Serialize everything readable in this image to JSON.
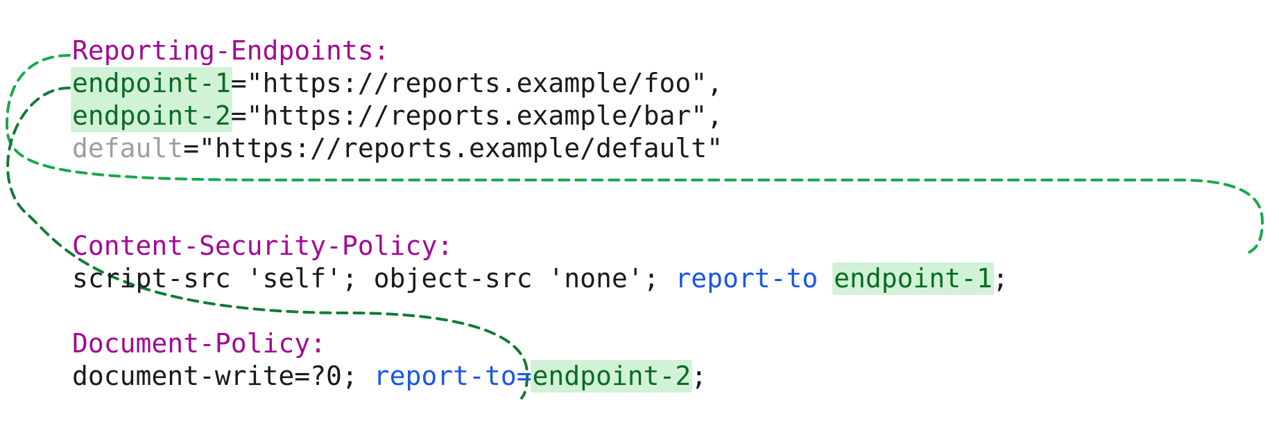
{
  "headers": {
    "reporting": "Reporting-Endpoints:",
    "csp": "Content-Security-Policy:",
    "doc": "Document-Policy:"
  },
  "endpoints": {
    "e1_name": "endpoint-1",
    "e1_rest": "=\"https://reports.example/foo\",",
    "e2_name": "endpoint-2",
    "e2_rest": "=\"https://reports.example/bar\",",
    "def_name": "default",
    "def_rest": "=\"https://reports.example/default\""
  },
  "csp": {
    "prefix": "script-src 'self'; object-src 'none'; ",
    "reportto": "report-to ",
    "endpoint": "endpoint-1",
    "tail": ";"
  },
  "docpolicy": {
    "prefix": "document-write=?0; ",
    "reportto": "report-to=",
    "endpoint": "endpoint-2",
    "tail": ";"
  },
  "colors": {
    "header": "#a30795",
    "highlight_bg": "#d1f2d6",
    "green_text": "#0b6b23",
    "blue_text": "#1a56e8",
    "gray_text": "#9e9e9e",
    "arrow_light": "#18a948",
    "arrow_dark": "#127a35"
  }
}
